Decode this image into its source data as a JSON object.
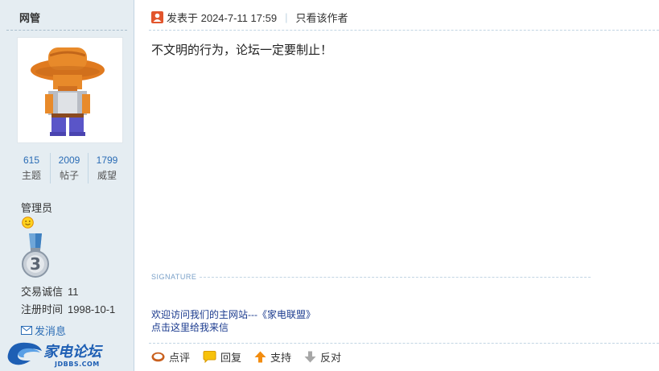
{
  "user": {
    "name": "网管",
    "stats": [
      {
        "value": "615",
        "label": "主题"
      },
      {
        "value": "2009",
        "label": "帖子"
      },
      {
        "value": "1799",
        "label": "威望"
      }
    ],
    "group": "管理员",
    "credit_label": "交易诚信",
    "credit_value": "11",
    "register_label": "注册时间",
    "register_value": "1998-10-1",
    "send_message": "发消息"
  },
  "post": {
    "posted_label": "发表于 2024-7-11 17:59",
    "only_author": "只看该作者",
    "separator": "|",
    "content": "不文明的行为，论坛一定要制止！",
    "signature_label": "SIGNATURE",
    "signature_links": [
      "欢迎访问我们的主网站---《家电联盟》",
      "点击这里给我来信"
    ],
    "actions": [
      "点评",
      "回复",
      "支持",
      "反对"
    ]
  },
  "logo": {
    "name": "家电论坛",
    "site": "JDBBS.COM"
  },
  "colors": {
    "sidebar": "#e5edf2",
    "link": "#2a6cb5",
    "logo": "#1e5fb4"
  }
}
